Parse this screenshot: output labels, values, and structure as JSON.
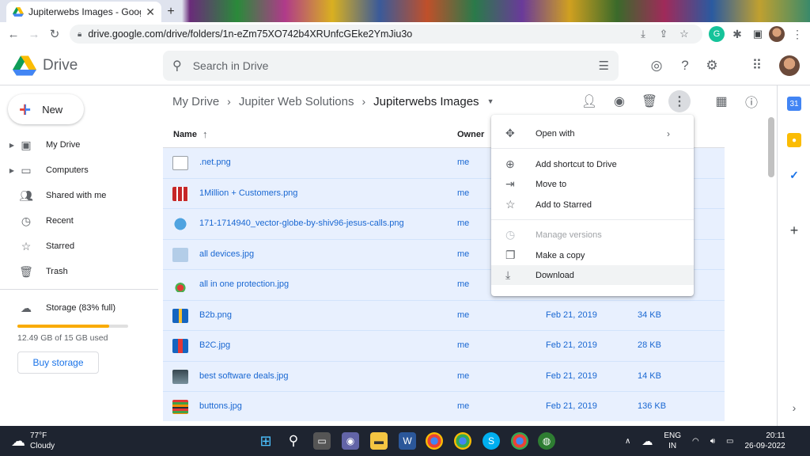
{
  "browser": {
    "tab_title": "Jupiterwebs Images - Google Dri",
    "url": "drive.google.com/drive/folders/1n-eZm75XO742b4XRUnfcGEke2YmJiu3o"
  },
  "header": {
    "logo_text": "Drive",
    "search_placeholder": "Search in Drive"
  },
  "sidebar": {
    "new_label": "New",
    "items": [
      {
        "label": "My Drive",
        "icon": "my-drive-icon"
      },
      {
        "label": "Computers",
        "icon": "computers-icon"
      },
      {
        "label": "Shared with me",
        "icon": "shared-icon"
      },
      {
        "label": "Recent",
        "icon": "clock-icon"
      },
      {
        "label": "Starred",
        "icon": "star-icon"
      },
      {
        "label": "Trash",
        "icon": "trash-icon"
      }
    ],
    "storage_label": "Storage (83% full)",
    "storage_used": "12.49 GB of 15 GB used",
    "storage_fraction": 0.83,
    "buy_label": "Buy storage"
  },
  "breadcrumb": {
    "items": [
      "My Drive",
      "Jupiter Web Solutions",
      "Jupiterwebs Images"
    ]
  },
  "list": {
    "headers": {
      "name": "Name",
      "owner": "Owner"
    },
    "rows": [
      {
        "name": ".net.png",
        "owner": "me",
        "modified": "",
        "size": ""
      },
      {
        "name": "1Million + Customers.png",
        "owner": "me",
        "modified": "",
        "size": ""
      },
      {
        "name": "171-1714940_vector-globe-by-shiv96-jesus-calls.png",
        "owner": "me",
        "modified": "",
        "size": ""
      },
      {
        "name": "all devices.jpg",
        "owner": "me",
        "modified": "",
        "size": ""
      },
      {
        "name": "all in one protection.jpg",
        "owner": "me",
        "modified": "",
        "size": ""
      },
      {
        "name": "B2b.png",
        "owner": "me",
        "modified": "Feb 21, 2019",
        "size": "34 KB"
      },
      {
        "name": "B2C.jpg",
        "owner": "me",
        "modified": "Feb 21, 2019",
        "size": "28 KB"
      },
      {
        "name": "best software deals.jpg",
        "owner": "me",
        "modified": "Feb 21, 2019",
        "size": "14 KB"
      },
      {
        "name": "buttons.jpg",
        "owner": "me",
        "modified": "Feb 21, 2019",
        "size": "136 KB"
      }
    ]
  },
  "context_menu": {
    "items": [
      {
        "label": "Open with",
        "icon": "open-with-icon"
      },
      {
        "label": "Add shortcut to Drive",
        "icon": "add-shortcut-icon"
      },
      {
        "label": "Move to",
        "icon": "move-to-icon"
      },
      {
        "label": "Add to Starred",
        "icon": "star-icon"
      },
      {
        "label": "Manage versions",
        "icon": "history-icon"
      },
      {
        "label": "Make a copy",
        "icon": "copy-icon"
      },
      {
        "label": "Download",
        "icon": "download-icon"
      }
    ]
  },
  "taskbar": {
    "temp": "77°F",
    "weather": "Cloudy",
    "lang1": "ENG",
    "lang2": "IN",
    "time": "20:11",
    "date": "26-09-2022"
  },
  "colors": {
    "accent": "#1a73e8",
    "selection": "#e8f0fe",
    "storage": "#f9ab00"
  }
}
